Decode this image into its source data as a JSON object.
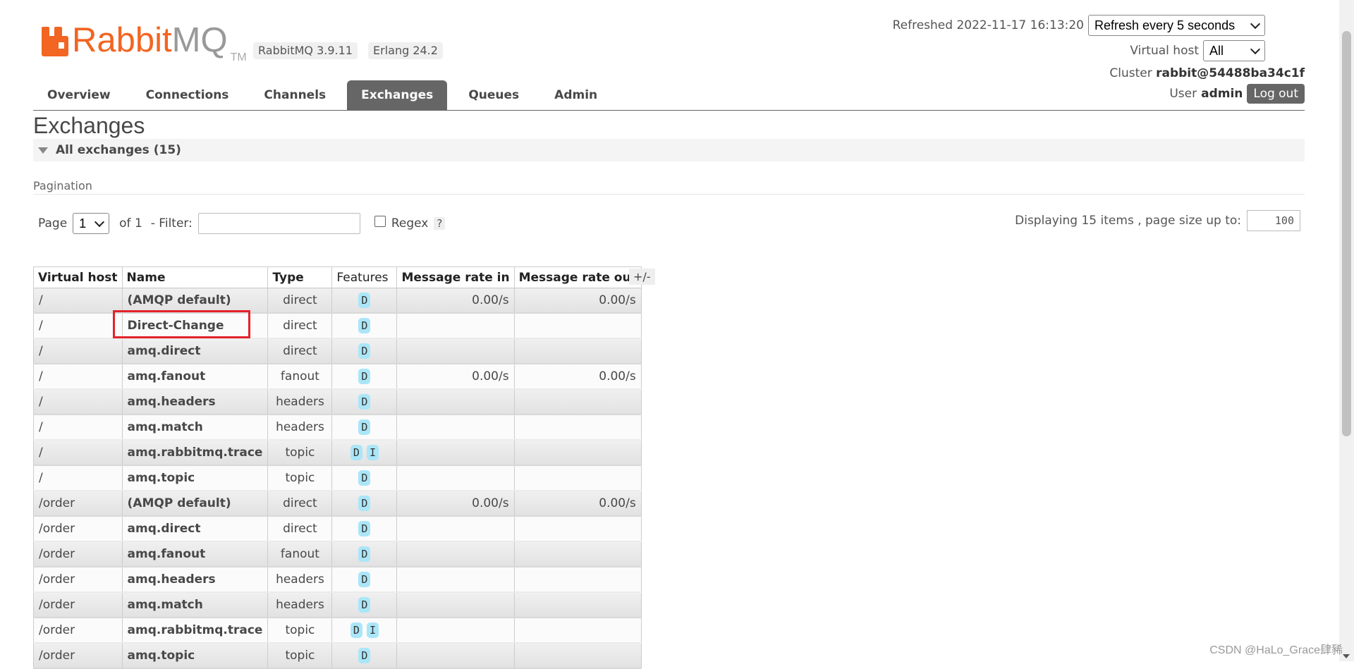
{
  "header": {
    "brand": {
      "rabbit": "Rabbit",
      "mq": "MQ",
      "tm": "TM"
    },
    "versions": [
      "RabbitMQ 3.9.11",
      "Erlang 24.2"
    ],
    "refreshed_label": "Refreshed 2022-11-17 16:13:20",
    "refresh_option": "Refresh every 5 seconds",
    "vhost_label": "Virtual host",
    "vhost_value": "All",
    "cluster_label": "Cluster",
    "cluster_value": "rabbit@54488ba34c1f",
    "user_label": "User",
    "user_value": "admin",
    "logout": "Log out"
  },
  "tabs": [
    {
      "label": "Overview",
      "active": false
    },
    {
      "label": "Connections",
      "active": false
    },
    {
      "label": "Channels",
      "active": false
    },
    {
      "label": "Exchanges",
      "active": true
    },
    {
      "label": "Queues",
      "active": false
    },
    {
      "label": "Admin",
      "active": false
    }
  ],
  "page": {
    "title": "Exchanges",
    "section": "All exchanges (15)",
    "pagination_label": "Pagination",
    "page_label": "Page",
    "page_value": "1",
    "of_label": "of 1",
    "filter_label": "- Filter:",
    "filter_value": "",
    "regex_label": "Regex",
    "help": "?",
    "display_label": "Displaying 15 items , page size up to:",
    "page_size": "100",
    "columns_toggle": "+/-"
  },
  "table": {
    "columns": [
      "Virtual host",
      "Name",
      "Type",
      "Features",
      "Message rate in",
      "Message rate out"
    ],
    "rows": [
      {
        "vhost": "/",
        "name": "(AMQP default)",
        "type": "direct",
        "features": [
          "D"
        ],
        "rate_in": "0.00/s",
        "rate_out": "0.00/s"
      },
      {
        "vhost": "/",
        "name": "Direct-Change",
        "type": "direct",
        "features": [
          "D"
        ],
        "rate_in": "",
        "rate_out": ""
      },
      {
        "vhost": "/",
        "name": "amq.direct",
        "type": "direct",
        "features": [
          "D"
        ],
        "rate_in": "",
        "rate_out": ""
      },
      {
        "vhost": "/",
        "name": "amq.fanout",
        "type": "fanout",
        "features": [
          "D"
        ],
        "rate_in": "0.00/s",
        "rate_out": "0.00/s"
      },
      {
        "vhost": "/",
        "name": "amq.headers",
        "type": "headers",
        "features": [
          "D"
        ],
        "rate_in": "",
        "rate_out": ""
      },
      {
        "vhost": "/",
        "name": "amq.match",
        "type": "headers",
        "features": [
          "D"
        ],
        "rate_in": "",
        "rate_out": ""
      },
      {
        "vhost": "/",
        "name": "amq.rabbitmq.trace",
        "type": "topic",
        "features": [
          "D",
          "I"
        ],
        "rate_in": "",
        "rate_out": ""
      },
      {
        "vhost": "/",
        "name": "amq.topic",
        "type": "topic",
        "features": [
          "D"
        ],
        "rate_in": "",
        "rate_out": ""
      },
      {
        "vhost": "/order",
        "name": "(AMQP default)",
        "type": "direct",
        "features": [
          "D"
        ],
        "rate_in": "0.00/s",
        "rate_out": "0.00/s"
      },
      {
        "vhost": "/order",
        "name": "amq.direct",
        "type": "direct",
        "features": [
          "D"
        ],
        "rate_in": "",
        "rate_out": ""
      },
      {
        "vhost": "/order",
        "name": "amq.fanout",
        "type": "fanout",
        "features": [
          "D"
        ],
        "rate_in": "",
        "rate_out": ""
      },
      {
        "vhost": "/order",
        "name": "amq.headers",
        "type": "headers",
        "features": [
          "D"
        ],
        "rate_in": "",
        "rate_out": ""
      },
      {
        "vhost": "/order",
        "name": "amq.match",
        "type": "headers",
        "features": [
          "D"
        ],
        "rate_in": "",
        "rate_out": ""
      },
      {
        "vhost": "/order",
        "name": "amq.rabbitmq.trace",
        "type": "topic",
        "features": [
          "D",
          "I"
        ],
        "rate_in": "",
        "rate_out": ""
      },
      {
        "vhost": "/order",
        "name": "amq.topic",
        "type": "topic",
        "features": [
          "D"
        ],
        "rate_in": "",
        "rate_out": ""
      }
    ]
  },
  "colors": {
    "brand_orange": "#f26522",
    "active_tab": "#666666",
    "feature_badge": "#aae6f8",
    "highlight": "#e3232b"
  },
  "watermark": "CSDN @HaLo_Grace肆豨"
}
